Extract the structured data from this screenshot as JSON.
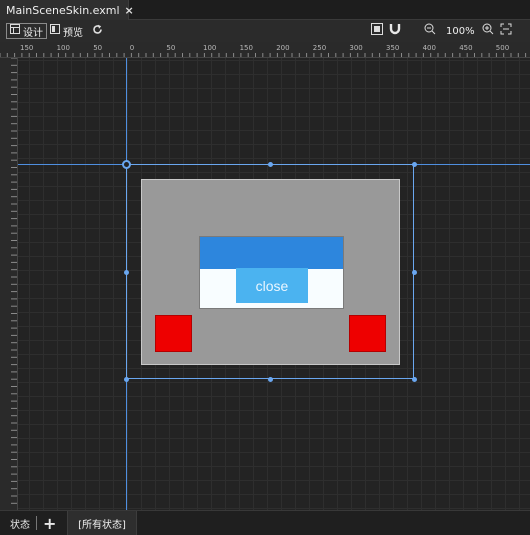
{
  "tab": {
    "title": "MainSceneSkin.exml",
    "close": "×"
  },
  "toolbar": {
    "design_label": "设计",
    "preview_label": "预览",
    "zoom_value": "100%"
  },
  "ruler": {
    "top_labels": [
      "150",
      "100",
      "50",
      "0",
      "50",
      "100",
      "150",
      "200",
      "250",
      "300",
      "350",
      "400",
      "450",
      "500"
    ]
  },
  "skin": {
    "close_label": "close",
    "colors": {
      "stage": "#999999",
      "header": "#2d86dd",
      "button": "#4bb3f0",
      "box": "#ee0000"
    }
  },
  "statusbar": {
    "state_label": "状态",
    "add_label": "+",
    "all_states_label": "[所有状态]"
  }
}
